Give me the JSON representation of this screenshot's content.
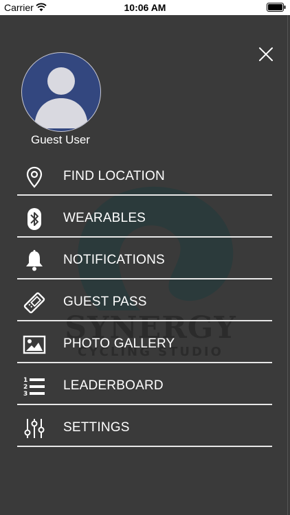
{
  "status_bar": {
    "carrier": "Carrier",
    "time": "10:06 AM"
  },
  "profile": {
    "name": "Guest User",
    "avatar_bg": "#33477f"
  },
  "menu": {
    "items": [
      {
        "label": "FIND LOCATION",
        "icon": "location-pin-icon"
      },
      {
        "label": "WEARABLES",
        "icon": "bluetooth-icon"
      },
      {
        "label": "NOTIFICATIONS",
        "icon": "bell-icon"
      },
      {
        "label": "GUEST PASS",
        "icon": "ticket-icon"
      },
      {
        "label": "PHOTO GALLERY",
        "icon": "image-icon"
      },
      {
        "label": "LEADERBOARD",
        "icon": "ranked-list-icon"
      },
      {
        "label": "SETTINGS",
        "icon": "sliders-icon"
      }
    ]
  },
  "background_logo": {
    "word": "SYNERGY",
    "sub": "CYCLING STUDIO",
    "accent": "#1f3a3c"
  },
  "colors": {
    "drawer_bg": "#3a3a3a",
    "divider": "#e8e8e8",
    "text": "#ffffff"
  }
}
